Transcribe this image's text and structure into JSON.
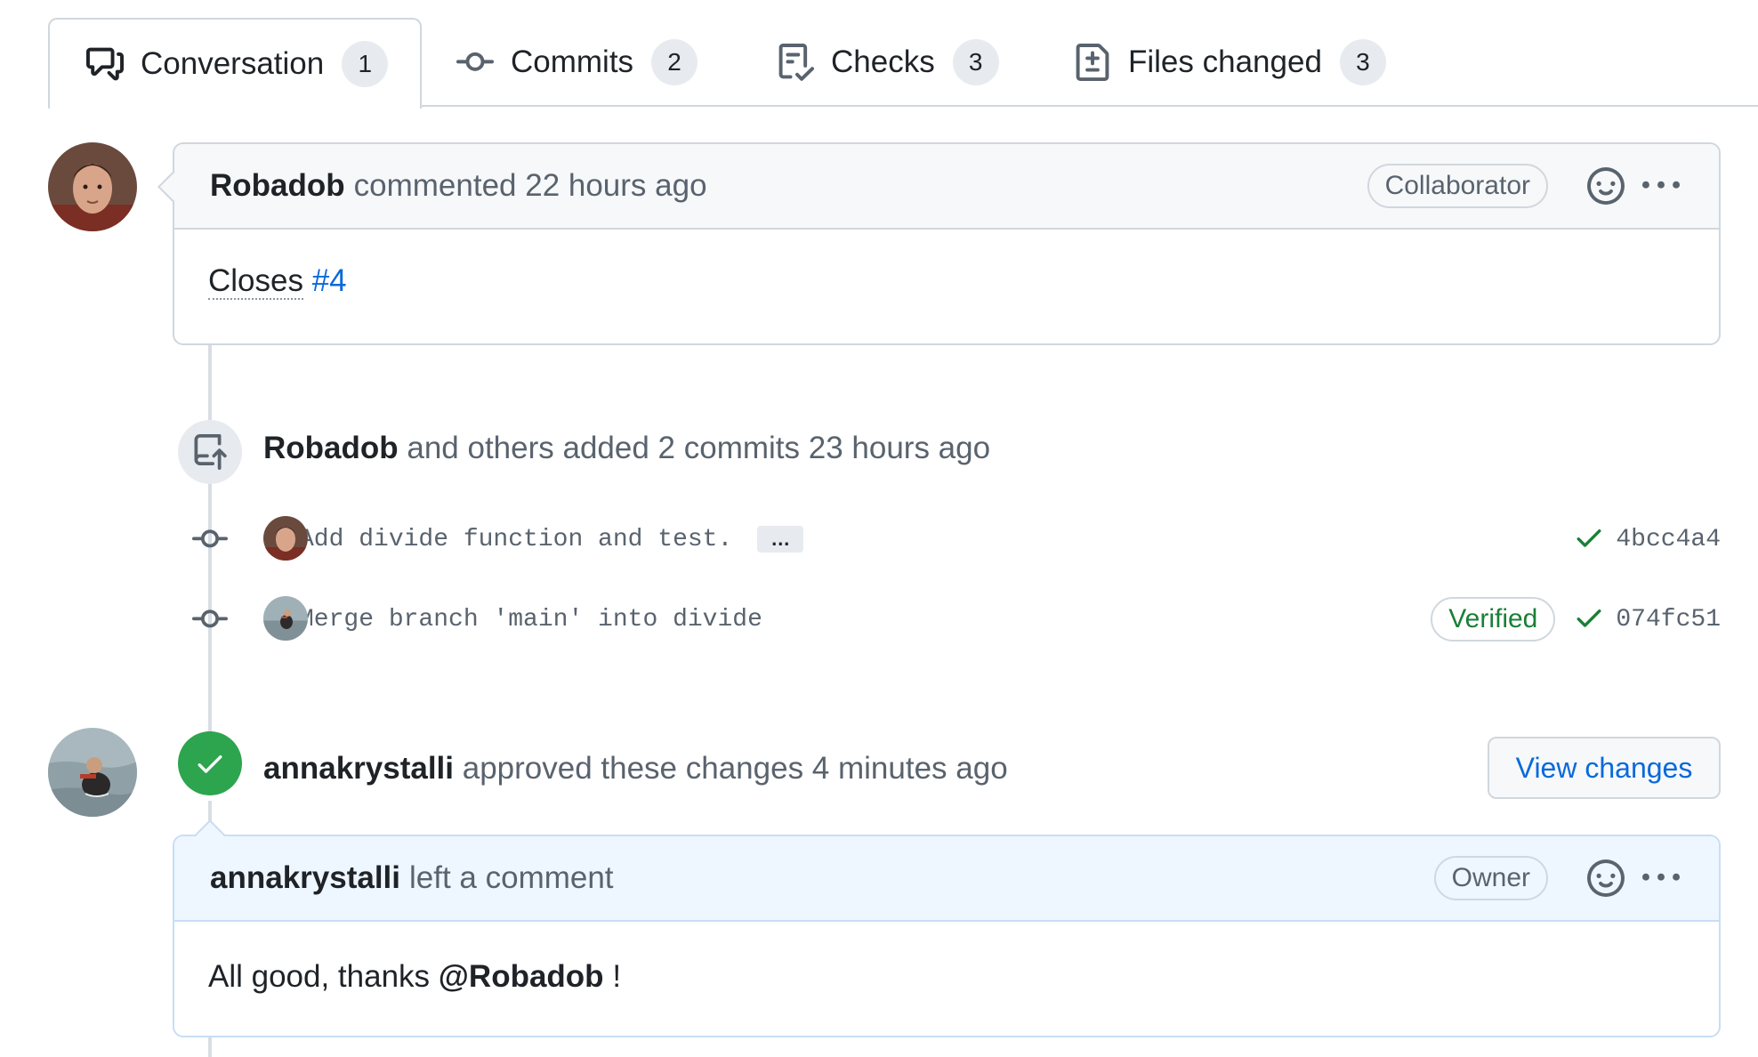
{
  "tabs": [
    {
      "label": "Conversation",
      "count": "1",
      "icon": "comment-discussion-icon"
    },
    {
      "label": "Commits",
      "count": "2",
      "icon": "git-commit-icon"
    },
    {
      "label": "Checks",
      "count": "3",
      "icon": "checklist-icon"
    },
    {
      "label": "Files changed",
      "count": "3",
      "icon": "file-diff-icon"
    }
  ],
  "comment1": {
    "author": "Robadob",
    "action": "commented 22 hours ago",
    "role": "Collaborator",
    "body_text": "Closes",
    "body_link": "#4"
  },
  "commit_event": {
    "author": "Robadob",
    "text": "and others added 2 commits 23 hours ago",
    "commits": [
      {
        "message": "Add divide function and test.",
        "expand": "…",
        "sha": "4bcc4a4",
        "verified": ""
      },
      {
        "message": "Merge branch 'main' into divide",
        "sha": "074fc51",
        "verified": "Verified"
      }
    ]
  },
  "review": {
    "author": "annakrystalli",
    "text": "approved these changes 4 minutes ago",
    "button": "View changes"
  },
  "comment2": {
    "author": "annakrystalli",
    "action": "left a comment",
    "role": "Owner",
    "body_prefix": "All good, thanks",
    "mention": "@Robadob",
    "body_suffix": "!"
  },
  "colors": {
    "link": "#0969da",
    "success": "#1a7f37",
    "approved_badge": "#2da44e",
    "border": "#d0d7de"
  }
}
